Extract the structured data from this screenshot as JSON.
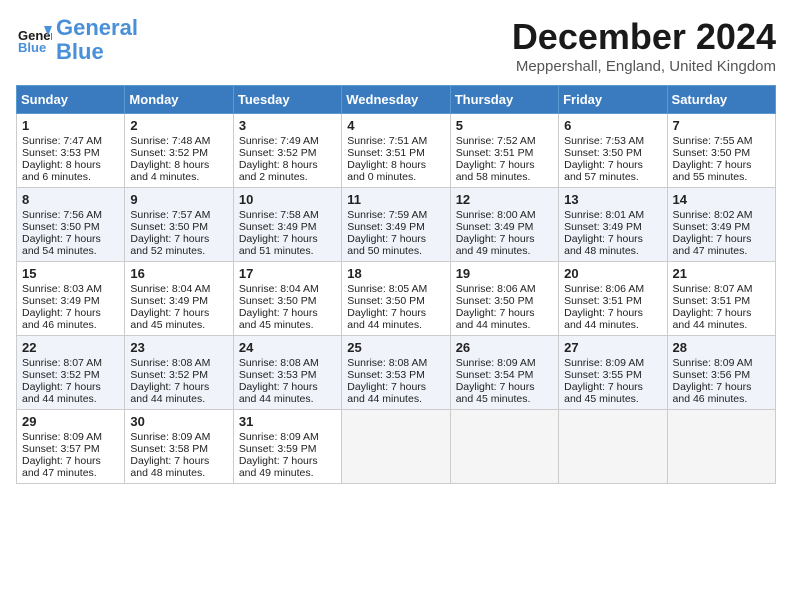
{
  "logo": {
    "line1": "General",
    "line2": "Blue"
  },
  "title": "December 2024",
  "location": "Meppershall, England, United Kingdom",
  "days_of_week": [
    "Sunday",
    "Monday",
    "Tuesday",
    "Wednesday",
    "Thursday",
    "Friday",
    "Saturday"
  ],
  "weeks": [
    [
      {
        "day": "1",
        "sunrise": "Sunrise: 7:47 AM",
        "sunset": "Sunset: 3:53 PM",
        "daylight": "Daylight: 8 hours and 6 minutes."
      },
      {
        "day": "2",
        "sunrise": "Sunrise: 7:48 AM",
        "sunset": "Sunset: 3:52 PM",
        "daylight": "Daylight: 8 hours and 4 minutes."
      },
      {
        "day": "3",
        "sunrise": "Sunrise: 7:49 AM",
        "sunset": "Sunset: 3:52 PM",
        "daylight": "Daylight: 8 hours and 2 minutes."
      },
      {
        "day": "4",
        "sunrise": "Sunrise: 7:51 AM",
        "sunset": "Sunset: 3:51 PM",
        "daylight": "Daylight: 8 hours and 0 minutes."
      },
      {
        "day": "5",
        "sunrise": "Sunrise: 7:52 AM",
        "sunset": "Sunset: 3:51 PM",
        "daylight": "Daylight: 7 hours and 58 minutes."
      },
      {
        "day": "6",
        "sunrise": "Sunrise: 7:53 AM",
        "sunset": "Sunset: 3:50 PM",
        "daylight": "Daylight: 7 hours and 57 minutes."
      },
      {
        "day": "7",
        "sunrise": "Sunrise: 7:55 AM",
        "sunset": "Sunset: 3:50 PM",
        "daylight": "Daylight: 7 hours and 55 minutes."
      }
    ],
    [
      {
        "day": "8",
        "sunrise": "Sunrise: 7:56 AM",
        "sunset": "Sunset: 3:50 PM",
        "daylight": "Daylight: 7 hours and 54 minutes."
      },
      {
        "day": "9",
        "sunrise": "Sunrise: 7:57 AM",
        "sunset": "Sunset: 3:50 PM",
        "daylight": "Daylight: 7 hours and 52 minutes."
      },
      {
        "day": "10",
        "sunrise": "Sunrise: 7:58 AM",
        "sunset": "Sunset: 3:49 PM",
        "daylight": "Daylight: 7 hours and 51 minutes."
      },
      {
        "day": "11",
        "sunrise": "Sunrise: 7:59 AM",
        "sunset": "Sunset: 3:49 PM",
        "daylight": "Daylight: 7 hours and 50 minutes."
      },
      {
        "day": "12",
        "sunrise": "Sunrise: 8:00 AM",
        "sunset": "Sunset: 3:49 PM",
        "daylight": "Daylight: 7 hours and 49 minutes."
      },
      {
        "day": "13",
        "sunrise": "Sunrise: 8:01 AM",
        "sunset": "Sunset: 3:49 PM",
        "daylight": "Daylight: 7 hours and 48 minutes."
      },
      {
        "day": "14",
        "sunrise": "Sunrise: 8:02 AM",
        "sunset": "Sunset: 3:49 PM",
        "daylight": "Daylight: 7 hours and 47 minutes."
      }
    ],
    [
      {
        "day": "15",
        "sunrise": "Sunrise: 8:03 AM",
        "sunset": "Sunset: 3:49 PM",
        "daylight": "Daylight: 7 hours and 46 minutes."
      },
      {
        "day": "16",
        "sunrise": "Sunrise: 8:04 AM",
        "sunset": "Sunset: 3:49 PM",
        "daylight": "Daylight: 7 hours and 45 minutes."
      },
      {
        "day": "17",
        "sunrise": "Sunrise: 8:04 AM",
        "sunset": "Sunset: 3:50 PM",
        "daylight": "Daylight: 7 hours and 45 minutes."
      },
      {
        "day": "18",
        "sunrise": "Sunrise: 8:05 AM",
        "sunset": "Sunset: 3:50 PM",
        "daylight": "Daylight: 7 hours and 44 minutes."
      },
      {
        "day": "19",
        "sunrise": "Sunrise: 8:06 AM",
        "sunset": "Sunset: 3:50 PM",
        "daylight": "Daylight: 7 hours and 44 minutes."
      },
      {
        "day": "20",
        "sunrise": "Sunrise: 8:06 AM",
        "sunset": "Sunset: 3:51 PM",
        "daylight": "Daylight: 7 hours and 44 minutes."
      },
      {
        "day": "21",
        "sunrise": "Sunrise: 8:07 AM",
        "sunset": "Sunset: 3:51 PM",
        "daylight": "Daylight: 7 hours and 44 minutes."
      }
    ],
    [
      {
        "day": "22",
        "sunrise": "Sunrise: 8:07 AM",
        "sunset": "Sunset: 3:52 PM",
        "daylight": "Daylight: 7 hours and 44 minutes."
      },
      {
        "day": "23",
        "sunrise": "Sunrise: 8:08 AM",
        "sunset": "Sunset: 3:52 PM",
        "daylight": "Daylight: 7 hours and 44 minutes."
      },
      {
        "day": "24",
        "sunrise": "Sunrise: 8:08 AM",
        "sunset": "Sunset: 3:53 PM",
        "daylight": "Daylight: 7 hours and 44 minutes."
      },
      {
        "day": "25",
        "sunrise": "Sunrise: 8:08 AM",
        "sunset": "Sunset: 3:53 PM",
        "daylight": "Daylight: 7 hours and 44 minutes."
      },
      {
        "day": "26",
        "sunrise": "Sunrise: 8:09 AM",
        "sunset": "Sunset: 3:54 PM",
        "daylight": "Daylight: 7 hours and 45 minutes."
      },
      {
        "day": "27",
        "sunrise": "Sunrise: 8:09 AM",
        "sunset": "Sunset: 3:55 PM",
        "daylight": "Daylight: 7 hours and 45 minutes."
      },
      {
        "day": "28",
        "sunrise": "Sunrise: 8:09 AM",
        "sunset": "Sunset: 3:56 PM",
        "daylight": "Daylight: 7 hours and 46 minutes."
      }
    ],
    [
      {
        "day": "29",
        "sunrise": "Sunrise: 8:09 AM",
        "sunset": "Sunset: 3:57 PM",
        "daylight": "Daylight: 7 hours and 47 minutes."
      },
      {
        "day": "30",
        "sunrise": "Sunrise: 8:09 AM",
        "sunset": "Sunset: 3:58 PM",
        "daylight": "Daylight: 7 hours and 48 minutes."
      },
      {
        "day": "31",
        "sunrise": "Sunrise: 8:09 AM",
        "sunset": "Sunset: 3:59 PM",
        "daylight": "Daylight: 7 hours and 49 minutes."
      },
      null,
      null,
      null,
      null
    ]
  ]
}
